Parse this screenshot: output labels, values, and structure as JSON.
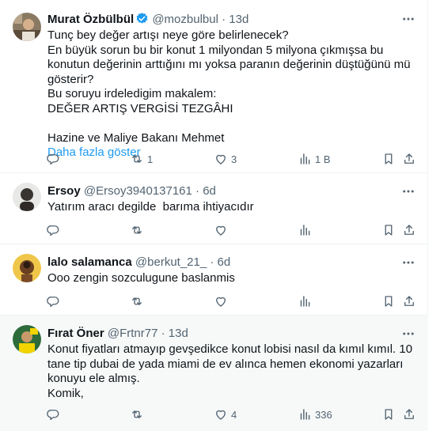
{
  "tweets": [
    {
      "name": "Murat Özbülbül",
      "handle": "@mozbulbul",
      "time": "13d",
      "verified": true,
      "text": "Tunç bey değer artışı neye göre belirlenecek?\nEn büyük sorun bu bir konut 1 milyondan 5 milyona çıkmışsa bu konutun değerinin arttığını mı yoksa paranın değerinin düştüğünü mü gösterir?\nBu soruyu irdeledigim makalem:\nDEĞER ARTIŞ VERGİSİ TEZGÂHI\n\nHazine ve Maliye Bakanı Mehmet",
      "show_more": "Daha fazla göster",
      "reply_count": "",
      "retweet_count": "1",
      "like_count": "3",
      "view_count": "1 B"
    },
    {
      "name": "Ersoy",
      "handle": "@Ersoy3940137161",
      "time": "6d",
      "text": "Yatırım aracı degilde  barıma ihtiyacıdır",
      "reply_count": "",
      "retweet_count": "",
      "like_count": "",
      "view_count": ""
    },
    {
      "name": "lalo salamanca",
      "handle": "@berkut_21_",
      "time": "6d",
      "text": "Ooo zengin sozculugune baslanmis",
      "reply_count": "",
      "retweet_count": "",
      "like_count": "",
      "view_count": ""
    },
    {
      "name": "Fırat Öner",
      "handle": "@Frtnr77",
      "time": "13d",
      "text": "Konut fiyatları atmayıp gevşedikce konut lobisi nasıl da kımıl kımıl. 10 tane tip dubai de yada miami de ev alınca hemen ekonomi yazarları konuyu ele almış.\nKomik,",
      "reply_count": "",
      "retweet_count": "",
      "like_count": "4",
      "view_count": "336"
    }
  ],
  "separator": "·",
  "colors": {
    "accent": "#1d9bf0",
    "muted": "#536471",
    "text": "#0f1419",
    "highlight_bg": "#f7f9f9"
  }
}
